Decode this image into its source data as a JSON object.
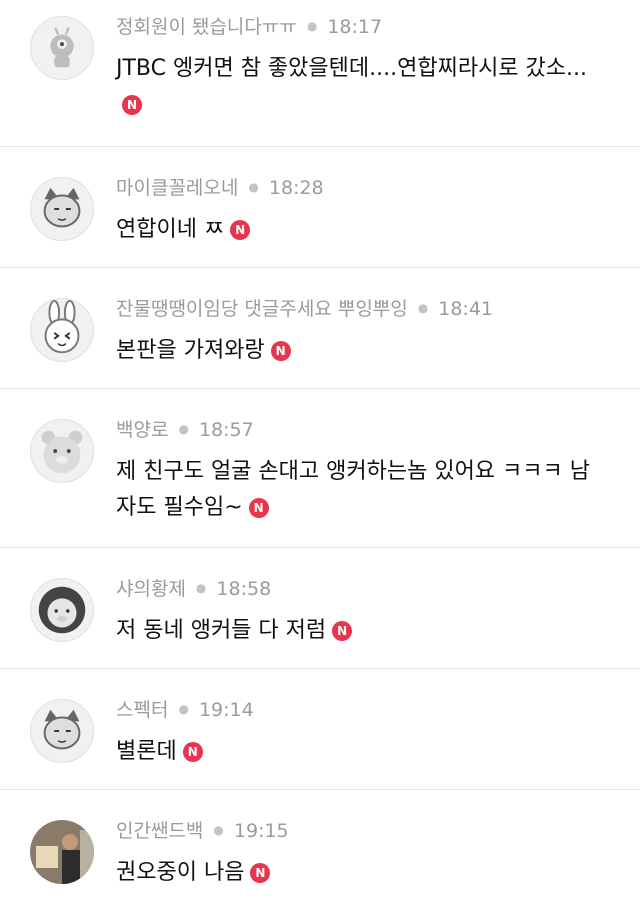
{
  "comments": [
    {
      "author": "정회원이 됐습니다ㅠㅠ",
      "time": "18:17",
      "text": "JTBC 엥커면 참 좋았을텐데....연합찌라시로 갔소...",
      "badge": "N",
      "avatar_icon": "alien-character-icon"
    },
    {
      "author": "마이클꼴레오네",
      "time": "18:28",
      "text": "연합이네 ㅉ",
      "badge": "N",
      "avatar_icon": "cat-character-icon"
    },
    {
      "author": "잔물땡땡이임당 댓글주세요 뿌잉뿌잉",
      "time": "18:41",
      "text": "본판을 가져와랑",
      "badge": "N",
      "avatar_icon": "rabbit-character-icon"
    },
    {
      "author": "백양로",
      "time": "18:57",
      "text": "제 친구도 얼굴 손대고 앵커하는놈 있어요 ㅋㅋㅋ  남자도 필수임~",
      "badge": "N",
      "avatar_icon": "bear-character-icon"
    },
    {
      "author": "샤의황제",
      "time": "18:58",
      "text": "저 동네 앵커들 다 저럼",
      "badge": "N",
      "avatar_icon": "lion-character-icon"
    },
    {
      "author": "스펙터",
      "time": "19:14",
      "text": "별론데",
      "badge": "N",
      "avatar_icon": "cat-character-icon"
    },
    {
      "author": "인간쌘드백",
      "time": "19:15",
      "text": "권오중이 나음",
      "badge": "N",
      "avatar_icon": "photo-avatar-icon"
    }
  ],
  "colors": {
    "badge": "#e8344e",
    "meta": "#9b9b9b",
    "text": "#111111",
    "divider": "#e4e4e4"
  }
}
